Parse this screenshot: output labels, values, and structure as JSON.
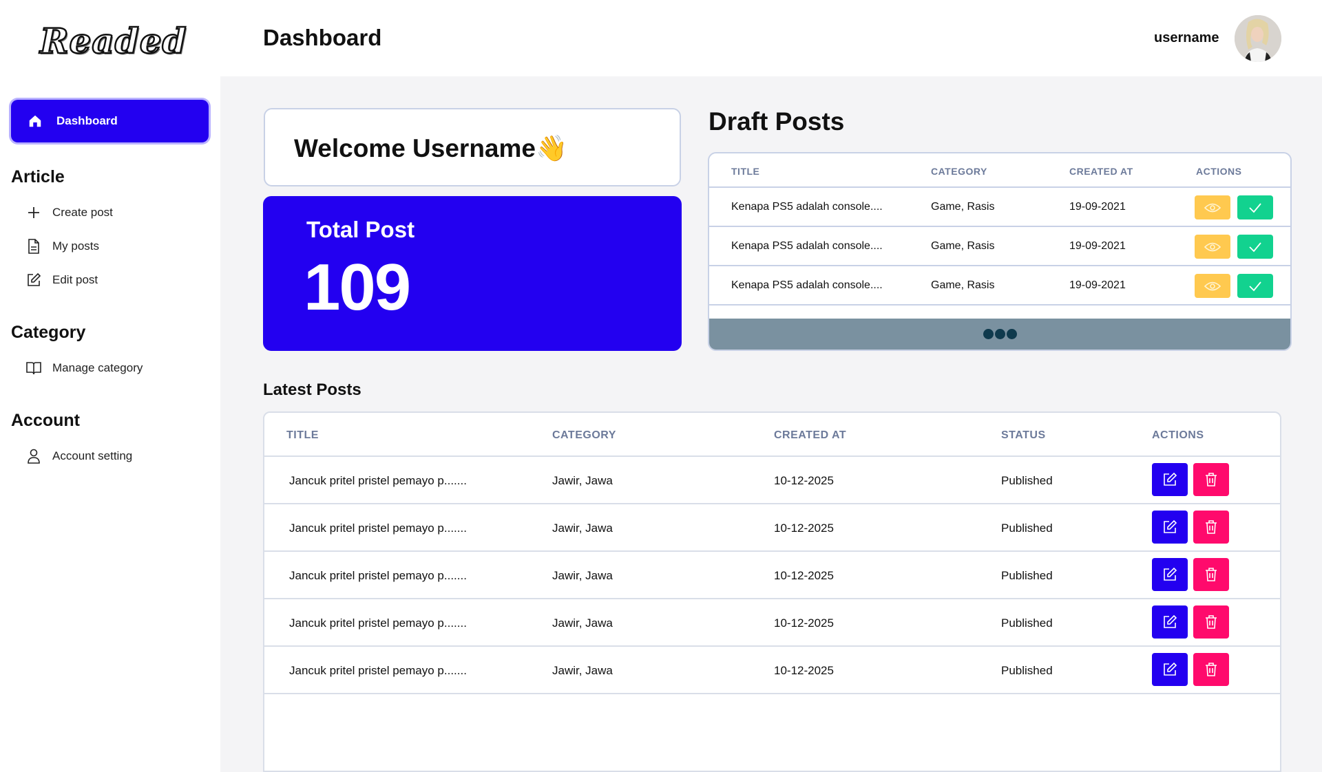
{
  "app": {
    "logo_text": "Readed",
    "page_title": "Dashboard"
  },
  "user": {
    "username": "username"
  },
  "sidebar": {
    "active_item": {
      "label": "Dashboard",
      "icon": "home-icon"
    },
    "sections": [
      {
        "title": "Article",
        "items": [
          {
            "label": "Create post",
            "icon": "plus-icon"
          },
          {
            "label": "My posts",
            "icon": "document-icon"
          },
          {
            "label": "Edit post",
            "icon": "edit-icon"
          }
        ]
      },
      {
        "title": "Category",
        "items": [
          {
            "label": "Manage category",
            "icon": "book-icon"
          }
        ]
      },
      {
        "title": "Account",
        "items": [
          {
            "label": "Account setting",
            "icon": "user-icon"
          }
        ]
      }
    ]
  },
  "welcome": {
    "text": "Welcome Username",
    "emoji": "👋"
  },
  "total_post": {
    "label": "Total Post",
    "value": "109"
  },
  "draft_posts": {
    "title": "Draft Posts",
    "columns": [
      "TITLE",
      "CATEGORY",
      "CREATED AT",
      "ACTIONS"
    ],
    "rows": [
      {
        "title": "Kenapa PS5 adalah console....",
        "category": "Game, Rasis",
        "created_at": "19-09-2021"
      },
      {
        "title": "Kenapa PS5 adalah console....",
        "category": "Game, Rasis",
        "created_at": "19-09-2021"
      },
      {
        "title": "Kenapa PS5 adalah console....",
        "category": "Game, Rasis",
        "created_at": "19-09-2021"
      }
    ]
  },
  "latest_posts": {
    "title": "Latest Posts",
    "columns": [
      "TITLE",
      "CATEGORY",
      "CREATED AT",
      "STATUS",
      "ACTIONS"
    ],
    "rows": [
      {
        "title": "Jancuk pritel pristel pemayo p.......",
        "category": "Jawir, Jawa",
        "created_at": "10-12-2025",
        "status": "Published"
      },
      {
        "title": "Jancuk pritel pristel pemayo p.......",
        "category": "Jawir, Jawa",
        "created_at": "10-12-2025",
        "status": "Published"
      },
      {
        "title": "Jancuk pritel pristel pemayo p.......",
        "category": "Jawir, Jawa",
        "created_at": "10-12-2025",
        "status": "Published"
      },
      {
        "title": "Jancuk pritel pristel pemayo p.......",
        "category": "Jawir, Jawa",
        "created_at": "10-12-2025",
        "status": "Published"
      },
      {
        "title": "Jancuk pritel pristel pemayo p.......",
        "category": "Jawir, Jawa",
        "created_at": "10-12-2025",
        "status": "Published"
      }
    ]
  },
  "colors": {
    "primary": "#2300f0",
    "view_button": "#ffc94f",
    "approve_button": "#12d28f",
    "delete_button": "#ff0a6c",
    "table_header_text": "#6c7a9a",
    "footer_bar": "#7a91a0"
  }
}
